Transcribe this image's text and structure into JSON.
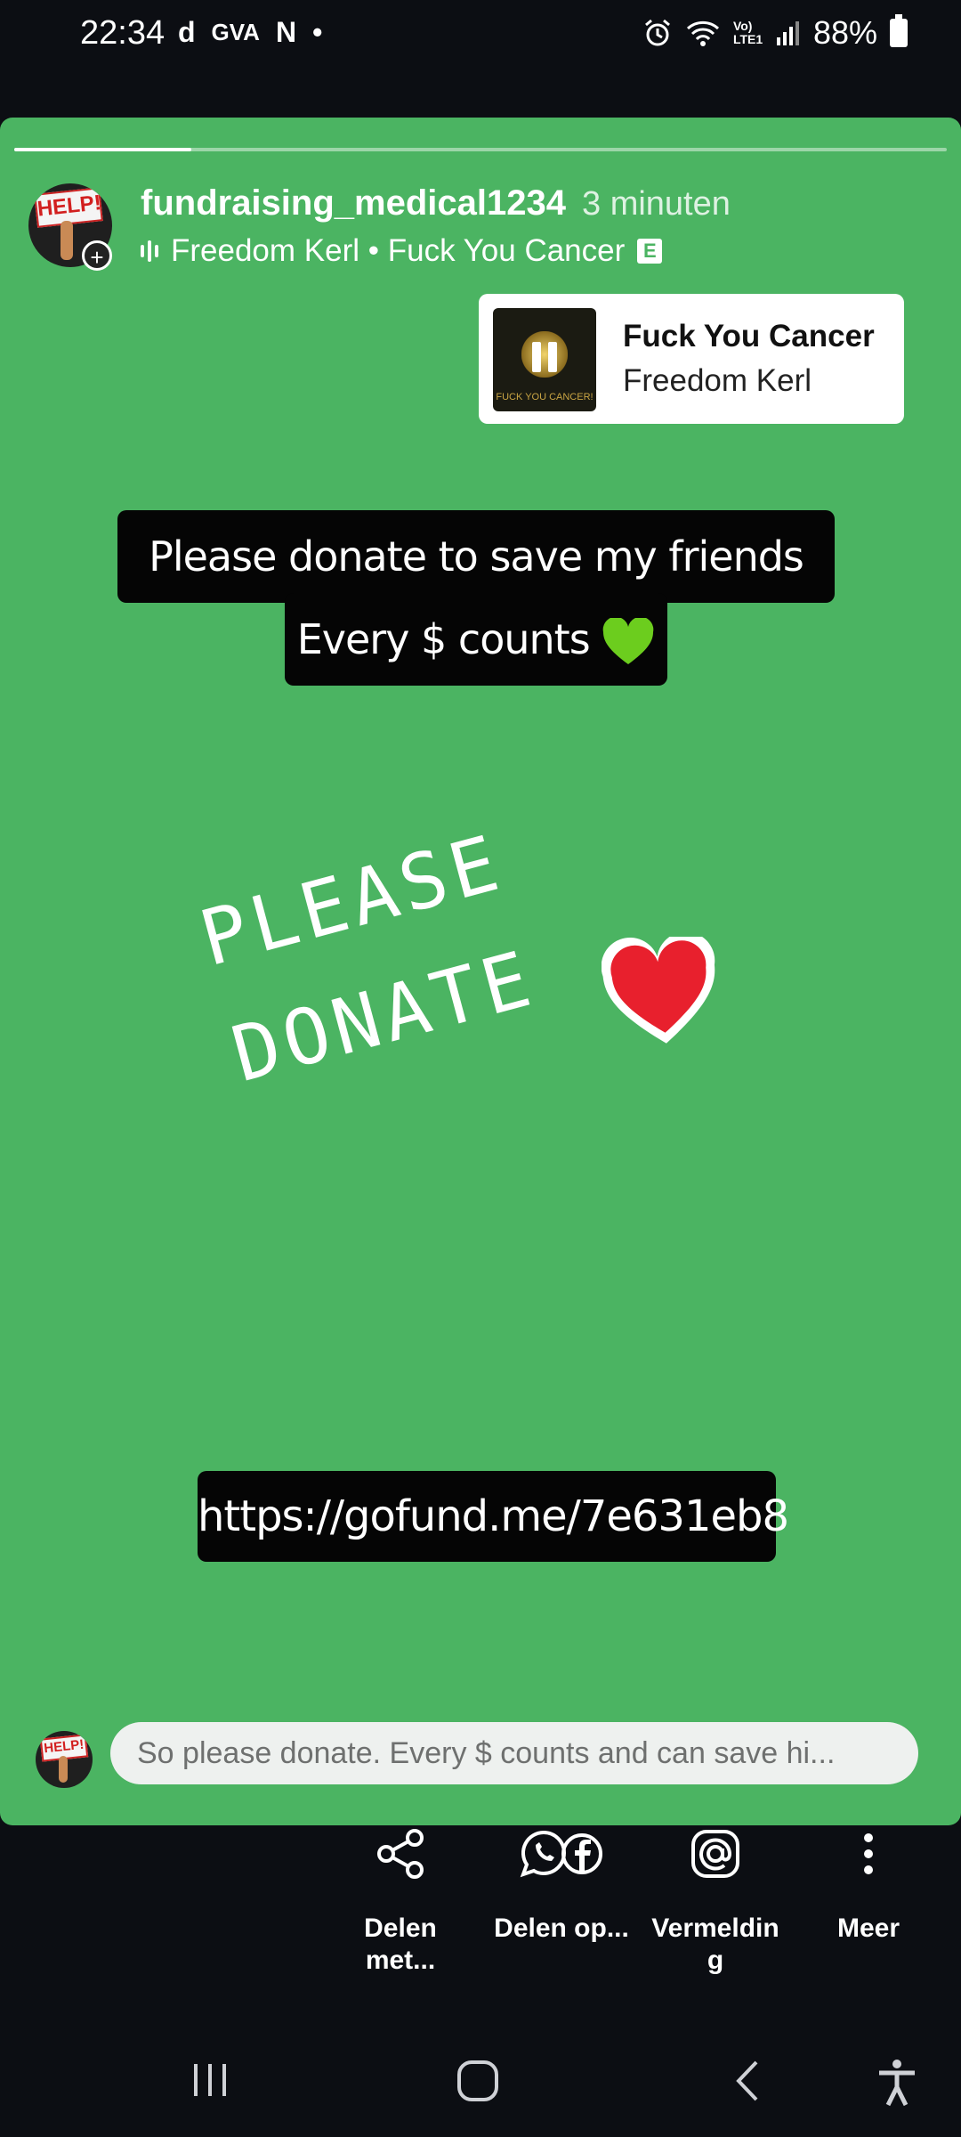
{
  "status_bar": {
    "time": "22:34",
    "left_icons": [
      "d",
      "GVA",
      "N",
      "•"
    ],
    "network_label": "Vo) LTE1",
    "battery_percent": "88%"
  },
  "story": {
    "background_color": "#4bb462",
    "progress": 0.19,
    "username": "fundraising_medical1234",
    "time_ago": "3 minuten",
    "music_line": "Freedom Kerl • Fuck You Cancer",
    "explicit_badge": "E",
    "avatar_sign": "HELP!",
    "music_card": {
      "title": "Fuck You Cancer",
      "artist": "Freedom Kerl",
      "album_text": "FUCK YOU CANCER!"
    },
    "caption_line1": "Please donate to save my friends life.",
    "caption_line2": "Every $ counts",
    "handwritten_line1": "PLEASE",
    "handwritten_line2": "DONATE",
    "link": "https://gofund.me/7e631eb8",
    "reply_text": "So please donate. Every $ counts and can save hi..."
  },
  "share_bar": [
    {
      "label": "Delen met...",
      "icon": "share-icon"
    },
    {
      "label": "Delen op...",
      "icon": "whatsapp-facebook-icon"
    },
    {
      "label": "Vermelding",
      "icon": "at-mention-icon"
    },
    {
      "label": "Meer",
      "icon": "more-vertical-icon"
    }
  ],
  "share_labels_lines": {
    "share_1a": "Delen",
    "share_1b": "met...",
    "share_3a": "Vermeldin",
    "share_3b": "g"
  },
  "nav_bar": [
    "recent-apps-icon",
    "home-icon",
    "back-icon",
    "accessibility-icon"
  ]
}
